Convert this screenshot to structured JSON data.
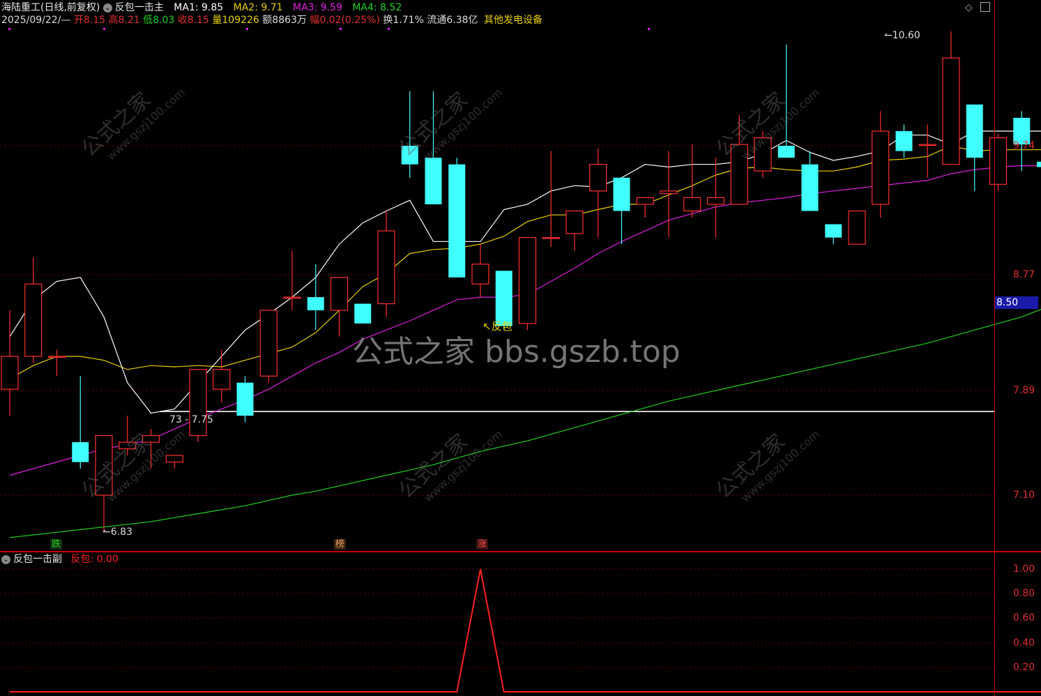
{
  "header": {
    "stock_name": "海陆重工(日线,前复权)",
    "indicator_main": "反包一击主",
    "ma": [
      {
        "label": "MA1: 9.85",
        "color": "#ffffff"
      },
      {
        "label": "MA2: 9.71",
        "color": "#e8d000"
      },
      {
        "label": "MA3: 9.59",
        "color": "#e020e0"
      },
      {
        "label": "MA4: 8.52",
        "color": "#20d020"
      }
    ]
  },
  "quote": {
    "date": "2025/09/22/—",
    "open_label": "开",
    "open": "8.15",
    "high_label": "高",
    "high": "8.21",
    "low_label": "低",
    "low": "8.03",
    "close_label": "收",
    "close": "8.15",
    "volume_label": "量",
    "volume": "109226",
    "amount_label": "额",
    "amount": "8863万",
    "change_label": "幅",
    "change": "0.02(0.25%)",
    "turnover_label": "换",
    "turnover": "1.71%",
    "float_label": "流通",
    "float": "6.38亿",
    "sector": "其他发电设备"
  },
  "axis": {
    "price_ticks": [
      "9.74",
      "8.77",
      "7.89",
      "7.10"
    ],
    "last_price": "8.50",
    "sub_ticks": [
      "1.00",
      "0.80",
      "0.60",
      "0.40",
      "0.20"
    ]
  },
  "annotations": {
    "high_mark": "10.60",
    "low_mark": "6.83",
    "range_label": "73 - 7.75",
    "signal_label": "反包",
    "badge_die": "跌",
    "badge_bang": "榜",
    "badge_zhang": "涨"
  },
  "watermark": {
    "main": "公式之家 bbs.gszb.top",
    "tile_text": "公式之家",
    "tile_url": "www.gszj100.com"
  },
  "sub_panel": {
    "title": "反包一击副",
    "series_label": "反包: 0.00"
  },
  "colors": {
    "up": "#ff3030",
    "down": "#40ffff",
    "ma1": "#ffffff",
    "ma2": "#e8d000",
    "ma3": "#e020e0",
    "ma4": "#20d020",
    "signal": "#ff2020"
  },
  "chart_data": {
    "type": "candlestick",
    "y_ticks": [
      9.74,
      8.77,
      7.89,
      7.1
    ],
    "candles": [
      {
        "o": 7.9,
        "h": 8.5,
        "l": 7.7,
        "c": 8.15
      },
      {
        "o": 8.15,
        "h": 8.9,
        "l": 8.1,
        "c": 8.7
      },
      {
        "o": 8.15,
        "h": 8.2,
        "l": 8.0,
        "c": 8.15
      },
      {
        "o": 7.5,
        "h": 8.0,
        "l": 7.3,
        "c": 7.35
      },
      {
        "o": 7.1,
        "h": 7.55,
        "l": 6.83,
        "c": 7.55
      },
      {
        "o": 7.45,
        "h": 7.7,
        "l": 7.4,
        "c": 7.5
      },
      {
        "o": 7.5,
        "h": 7.6,
        "l": 7.3,
        "c": 7.55
      },
      {
        "o": 7.35,
        "h": 7.4,
        "l": 7.3,
        "c": 7.4
      },
      {
        "o": 7.55,
        "h": 8.05,
        "l": 7.5,
        "c": 8.05
      },
      {
        "o": 7.9,
        "h": 8.2,
        "l": 7.8,
        "c": 8.05
      },
      {
        "o": 7.95,
        "h": 8.0,
        "l": 7.65,
        "c": 7.7
      },
      {
        "o": 8.0,
        "h": 8.5,
        "l": 7.95,
        "c": 8.5
      },
      {
        "o": 8.6,
        "h": 8.95,
        "l": 8.5,
        "c": 8.6
      },
      {
        "o": 8.6,
        "h": 8.85,
        "l": 8.35,
        "c": 8.5
      },
      {
        "o": 8.5,
        "h": 8.75,
        "l": 8.3,
        "c": 8.75
      },
      {
        "o": 8.55,
        "h": 8.55,
        "l": 8.4,
        "c": 8.4
      },
      {
        "o": 8.55,
        "h": 9.25,
        "l": 8.45,
        "c": 9.1
      },
      {
        "o": 9.74,
        "h": 10.15,
        "l": 9.5,
        "c": 9.6
      },
      {
        "o": 9.65,
        "h": 10.15,
        "l": 9.3,
        "c": 9.3
      },
      {
        "o": 9.6,
        "h": 9.65,
        "l": 8.75,
        "c": 8.75
      },
      {
        "o": 8.7,
        "h": 9.0,
        "l": 8.6,
        "c": 8.85
      },
      {
        "o": 8.8,
        "h": 8.8,
        "l": 8.35,
        "c": 8.38
      },
      {
        "o": 8.4,
        "h": 9.05,
        "l": 8.35,
        "c": 9.05
      },
      {
        "o": 9.05,
        "h": 9.7,
        "l": 8.98,
        "c": 9.05
      },
      {
        "o": 9.08,
        "h": 9.25,
        "l": 8.95,
        "c": 9.25
      },
      {
        "o": 9.4,
        "h": 9.72,
        "l": 9.05,
        "c": 9.6
      },
      {
        "o": 9.5,
        "h": 9.5,
        "l": 9.0,
        "c": 9.25
      },
      {
        "o": 9.3,
        "h": 9.35,
        "l": 9.2,
        "c": 9.35
      },
      {
        "o": 9.38,
        "h": 9.7,
        "l": 9.05,
        "c": 9.4
      },
      {
        "o": 9.25,
        "h": 9.75,
        "l": 9.2,
        "c": 9.35
      },
      {
        "o": 9.3,
        "h": 9.65,
        "l": 9.05,
        "c": 9.35
      },
      {
        "o": 9.3,
        "h": 9.97,
        "l": 9.3,
        "c": 9.75
      },
      {
        "o": 9.55,
        "h": 9.85,
        "l": 9.5,
        "c": 9.8
      },
      {
        "o": 9.74,
        "h": 10.5,
        "l": 9.65,
        "c": 9.65
      },
      {
        "o": 9.6,
        "h": 9.7,
        "l": 9.25,
        "c": 9.25
      },
      {
        "o": 9.15,
        "h": 9.15,
        "l": 9.0,
        "c": 9.05
      },
      {
        "o": 9.0,
        "h": 9.25,
        "l": 9.0,
        "c": 9.25
      },
      {
        "o": 9.3,
        "h": 10.0,
        "l": 9.2,
        "c": 9.85
      },
      {
        "o": 9.85,
        "h": 9.9,
        "l": 9.65,
        "c": 9.7
      },
      {
        "o": 9.75,
        "h": 9.9,
        "l": 9.5,
        "c": 9.75
      },
      {
        "o": 9.6,
        "h": 10.6,
        "l": 9.6,
        "c": 10.4
      },
      {
        "o": 10.05,
        "h": 10.05,
        "l": 9.4,
        "c": 9.65
      },
      {
        "o": 9.45,
        "h": 9.83,
        "l": 9.4,
        "c": 9.8
      },
      {
        "o": 9.95,
        "h": 10.0,
        "l": 9.55,
        "c": 9.75
      },
      {
        "o": 9.62,
        "h": 9.62,
        "l": 9.48,
        "c": 9.58
      }
    ],
    "ma1": [
      8.3,
      8.58,
      8.72,
      8.75,
      8.45,
      7.95,
      7.72,
      7.75,
      7.95,
      8.15,
      8.35,
      8.47,
      8.6,
      8.75,
      9.0,
      9.16,
      9.25,
      9.33,
      9.02,
      9.02,
      9.02,
      9.26,
      9.3,
      9.4,
      9.44,
      9.43,
      9.5,
      9.6,
      9.58,
      9.6,
      9.6,
      9.62,
      9.68,
      9.78,
      9.69,
      9.63,
      9.66,
      9.7,
      9.82,
      9.82,
      9.75,
      9.85,
      9.85,
      9.85,
      9.85
    ],
    "ma2": [
      7.98,
      8.08,
      8.15,
      8.15,
      8.12,
      8.05,
      8.08,
      8.07,
      8.08,
      8.07,
      8.12,
      8.17,
      8.22,
      8.33,
      8.5,
      8.68,
      8.78,
      8.93,
      8.96,
      8.97,
      9.0,
      9.06,
      9.17,
      9.22,
      9.22,
      9.26,
      9.3,
      9.3,
      9.37,
      9.44,
      9.52,
      9.57,
      9.58,
      9.56,
      9.55,
      9.55,
      9.58,
      9.63,
      9.64,
      9.66,
      9.74,
      9.7,
      9.71,
      9.71,
      9.71
    ],
    "ma3": [
      7.25,
      7.3,
      7.35,
      7.4,
      7.45,
      7.48,
      7.52,
      7.6,
      7.68,
      7.75,
      7.82,
      7.9,
      8.0,
      8.1,
      8.18,
      8.28,
      8.35,
      8.42,
      8.5,
      8.58,
      8.6,
      8.6,
      8.62,
      8.72,
      8.82,
      8.93,
      9.02,
      9.1,
      9.18,
      9.23,
      9.28,
      9.31,
      9.33,
      9.35,
      9.38,
      9.4,
      9.42,
      9.44,
      9.46,
      9.48,
      9.53,
      9.56,
      9.58,
      9.59,
      9.59
    ],
    "ma4": [
      6.78,
      6.8,
      6.82,
      6.84,
      6.86,
      6.88,
      6.9,
      6.93,
      6.96,
      6.99,
      7.02,
      7.06,
      7.1,
      7.13,
      7.17,
      7.21,
      7.25,
      7.29,
      7.33,
      7.38,
      7.43,
      7.47,
      7.51,
      7.56,
      7.61,
      7.66,
      7.71,
      7.76,
      7.81,
      7.85,
      7.89,
      7.93,
      7.97,
      8.01,
      8.05,
      8.09,
      8.13,
      8.17,
      8.21,
      8.25,
      8.3,
      8.35,
      8.4,
      8.45,
      8.52
    ],
    "support_line": 7.75,
    "signal": [
      0,
      0,
      0,
      0,
      0,
      0,
      0,
      0,
      0,
      0,
      0,
      0,
      0,
      0,
      0,
      0,
      0,
      0,
      0,
      0,
      1,
      0,
      0,
      0,
      0,
      0,
      0,
      0,
      0,
      0,
      0,
      0,
      0,
      0,
      0,
      0,
      0,
      0,
      0,
      0,
      0,
      0,
      0,
      0,
      0
    ]
  }
}
